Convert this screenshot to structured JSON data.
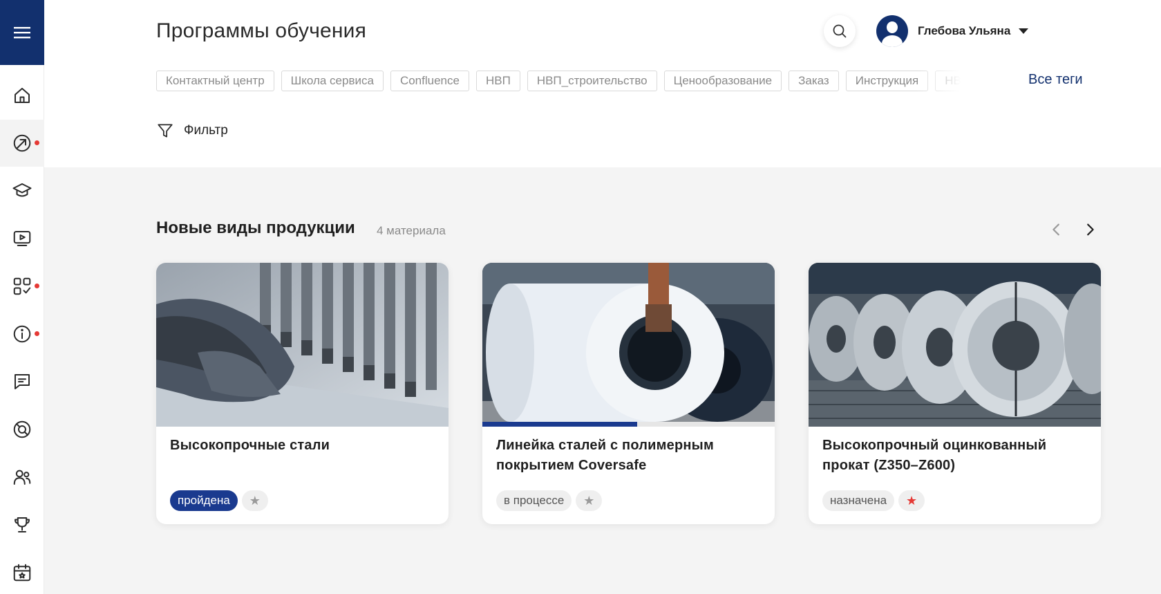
{
  "header": {
    "title": "Программы обучения",
    "user_name": "Глебова Ульяна",
    "all_tags_label": "Все теги",
    "filter_label": "Фильтр"
  },
  "tags": [
    "Контактный центр",
    "Школа сервиса",
    "Confluence",
    "НВП",
    "НВП_строительство",
    "Ценообразование",
    "Заказ",
    "Инструкция",
    "НВП_пр"
  ],
  "sidebar": {
    "items": [
      {
        "icon": "home-icon",
        "active": false,
        "dot": false
      },
      {
        "icon": "trajectory-icon",
        "active": true,
        "dot": true
      },
      {
        "icon": "graduation-cap-icon",
        "active": false,
        "dot": false
      },
      {
        "icon": "video-icon",
        "active": false,
        "dot": false
      },
      {
        "icon": "apps-icon",
        "active": false,
        "dot": true
      },
      {
        "icon": "info-icon",
        "active": false,
        "dot": true
      },
      {
        "icon": "chat-icon",
        "active": false,
        "dot": false
      },
      {
        "icon": "support-icon",
        "active": false,
        "dot": false
      },
      {
        "icon": "users-icon",
        "active": false,
        "dot": false
      },
      {
        "icon": "trophy-icon",
        "active": false,
        "dot": false
      },
      {
        "icon": "calendar-icon",
        "active": false,
        "dot": false
      }
    ]
  },
  "section": {
    "title": "Новые виды продукции",
    "count": "4 материала"
  },
  "cards": [
    {
      "title": "Высокопрочные стали",
      "status": "пройдена",
      "status_type": "done",
      "favorite": false,
      "progress": null,
      "image": "hands-press-brake-photo"
    },
    {
      "title": "Линейка сталей с полимерным покрытием Coversafe",
      "status": "в процессе",
      "status_type": "progress",
      "favorite": false,
      "progress": 0.53,
      "image": "coated-steel-coil-photo"
    },
    {
      "title": "Высокопрочный оцинкованный прокат (Z350–Z600)",
      "status": "назначена",
      "status_type": "assigned",
      "favorite": true,
      "progress": null,
      "image": "galvanized-coils-photo"
    }
  ],
  "colors": {
    "brand": "#12306e",
    "accent": "#1a3a8f",
    "dot": "#e53935"
  }
}
